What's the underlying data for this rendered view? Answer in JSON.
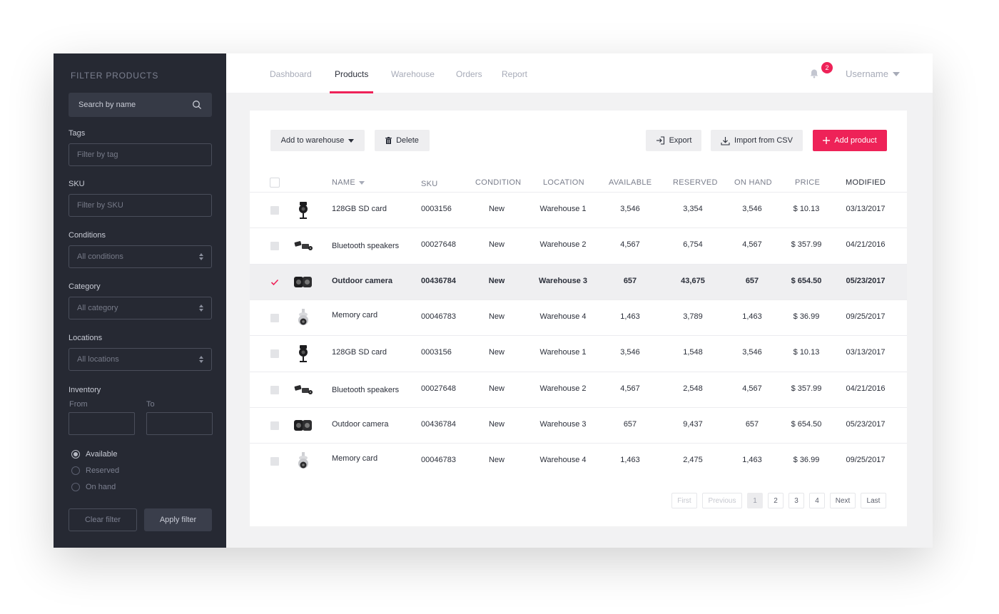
{
  "sidebar": {
    "title": "FILTER PRODUCTS",
    "search_placeholder": "Search by name",
    "tags_label": "Tags",
    "tags_placeholder": "Filter by tag",
    "sku_label": "SKU",
    "sku_placeholder": "Filter by SKU",
    "conditions_label": "Conditions",
    "conditions_value": "All conditions",
    "category_label": "Category",
    "category_value": "All category",
    "locations_label": "Locations",
    "locations_value": "All locations",
    "inventory_label": "Inventory",
    "from_label": "From",
    "to_label": "To",
    "radios": [
      {
        "label": "Available",
        "checked": true
      },
      {
        "label": "Reserved",
        "checked": false
      },
      {
        "label": "On hand",
        "checked": false
      }
    ],
    "clear_label": "Clear filter",
    "apply_label": "Apply filter"
  },
  "nav": {
    "tabs": [
      "Dashboard",
      "Products",
      "Warehouse",
      "Orders",
      "Report"
    ],
    "active": "Products",
    "notifications": "2",
    "username": "Username"
  },
  "toolbar": {
    "add_to_warehouse": "Add to warehouse",
    "delete": "Delete",
    "export": "Export",
    "import": "Import from CSV",
    "add_product": "Add product"
  },
  "table": {
    "headers": {
      "name": "NAME",
      "sku": "SKU",
      "condition": "CONDITION",
      "location": "LOCATION",
      "available": "AVAILABLE",
      "reserved": "RESERVED",
      "on_hand": "ON HAND",
      "price": "PRICE",
      "modified": "MODIFIED"
    },
    "rows": [
      {
        "name": "128GB SD card",
        "sku": "0003156",
        "condition": "New",
        "location": "Warehouse 1",
        "available": "3,546",
        "reserved": "3,354",
        "on_hand": "3,546",
        "price": "$ 10.13",
        "modified": "03/13/2017",
        "icon": "camera-dome-icon"
      },
      {
        "name": "Bluetooth speakers",
        "sku": "00027648",
        "condition": "New",
        "location": "Warehouse 2",
        "available": "4,567",
        "reserved": "6,754",
        "on_hand": "4,567",
        "price": "$ 357.99",
        "modified": "04/21/2016",
        "icon": "camera-pair-icon"
      },
      {
        "name": "Outdoor camera",
        "sku": "00436784",
        "condition": "New",
        "location": "Warehouse 3",
        "available": "657",
        "reserved": "43,675",
        "on_hand": "657",
        "price": "$ 654.50",
        "modified": "05/23/2017",
        "icon": "camera-box-icon"
      },
      {
        "name": "Memory card",
        "sku": "00046783",
        "condition": "New",
        "location": "Warehouse 4",
        "available": "1,463",
        "reserved": "3,789",
        "on_hand": "1,463",
        "price": "$ 36.99",
        "modified": "09/25/2017",
        "icon": "camera-ceiling-icon"
      },
      {
        "name": "128GB SD card",
        "sku": "0003156",
        "condition": "New",
        "location": "Warehouse 1",
        "available": "3,546",
        "reserved": "1,548",
        "on_hand": "3,546",
        "price": "$ 10.13",
        "modified": "03/13/2017",
        "icon": "camera-dome-icon"
      },
      {
        "name": "Bluetooth speakers",
        "sku": "00027648",
        "condition": "New",
        "location": "Warehouse 2",
        "available": "4,567",
        "reserved": "2,548",
        "on_hand": "4,567",
        "price": "$ 357.99",
        "modified": "04/21/2016",
        "icon": "camera-pair-icon"
      },
      {
        "name": "Outdoor camera",
        "sku": "00436784",
        "condition": "New",
        "location": "Warehouse 3",
        "available": "657",
        "reserved": "9,437",
        "on_hand": "657",
        "price": "$ 654.50",
        "modified": "05/23/2017",
        "icon": "camera-box-icon"
      },
      {
        "name": "Memory card",
        "sku": "00046783",
        "condition": "New",
        "location": "Warehouse 4",
        "available": "1,463",
        "reserved": "2,475",
        "on_hand": "1,463",
        "price": "$ 36.99",
        "modified": "09/25/2017",
        "icon": "camera-ceiling-icon"
      }
    ],
    "selected_row": 2
  },
  "pagination": {
    "first": "First",
    "previous": "Previous",
    "pages": [
      "1",
      "2",
      "3",
      "4"
    ],
    "current": "1",
    "next": "Next",
    "last": "Last"
  },
  "colors": {
    "accent": "#ee2258",
    "sidebar_bg": "#262933"
  }
}
